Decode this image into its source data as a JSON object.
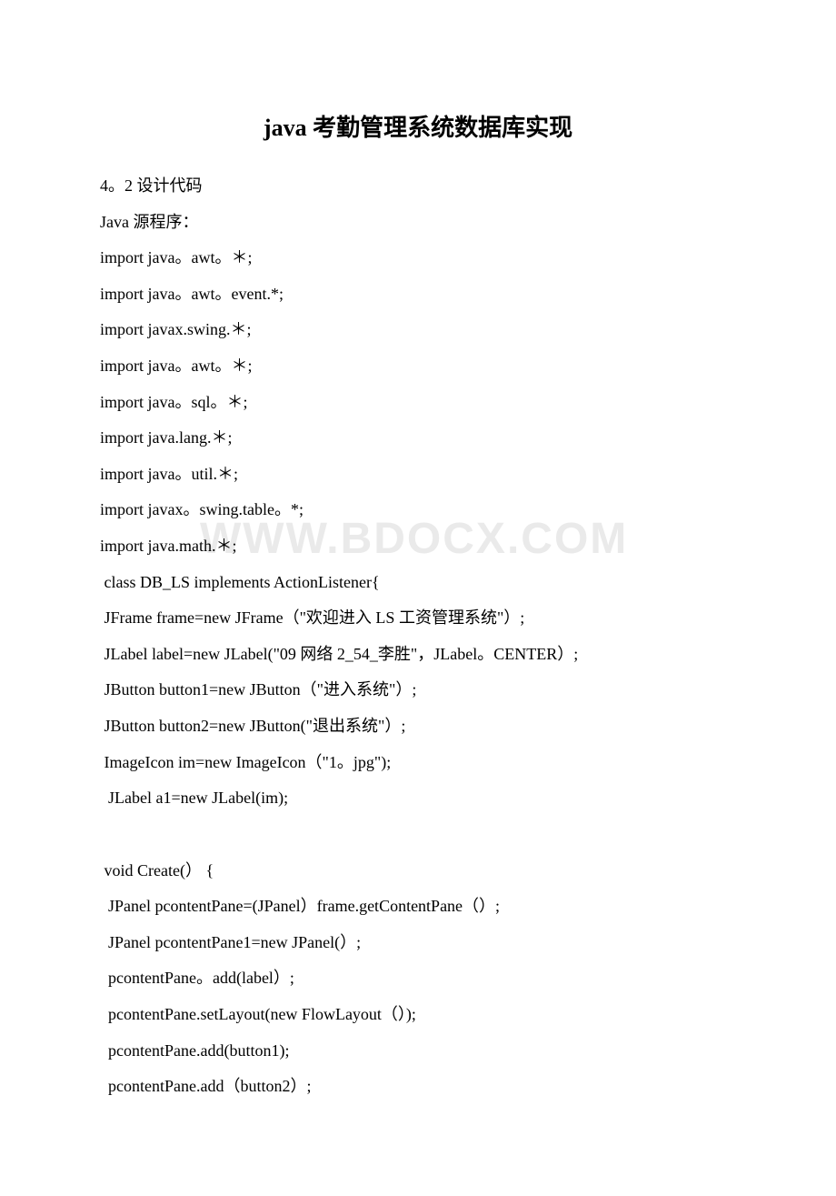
{
  "title": "java 考勤管理系统数据库实现",
  "watermark": "WWW.BDOCX.COM",
  "lines": [
    "4。2 设计代码",
    "Java 源程序：",
    "import java。awt。＊;",
    "import java。awt。event.*;",
    "import javax.swing.＊;",
    "import java。awt。＊;",
    "import java。sql。＊;",
    "import java.lang.＊;",
    "import java。util.＊;",
    "import javax。swing.table。*;",
    "import java.math.＊;",
    " class DB_LS implements ActionListener{",
    " JFrame frame=new JFrame（\"欢迎进入 LS 工资管理系统\"）;",
    " JLabel label=new JLabel(\"09 网络 2_54_李胜\"，JLabel。CENTER）;",
    " JButton button1=new JButton（\"进入系统\"）;",
    " JButton button2=new JButton(\"退出系统\"）;",
    " ImageIcon im=new ImageIcon（\"1。jpg\");",
    "  JLabel a1=new JLabel(im);",
    "",
    " void Create(） {",
    "  JPanel pcontentPane=(JPanel）frame.getContentPane（）;",
    "  JPanel pcontentPane1=new JPanel(）;",
    "  pcontentPane。add(label）;",
    "  pcontentPane.setLayout(new FlowLayout（）);",
    "  pcontentPane.add(button1);",
    "  pcontentPane.add（button2）;"
  ]
}
